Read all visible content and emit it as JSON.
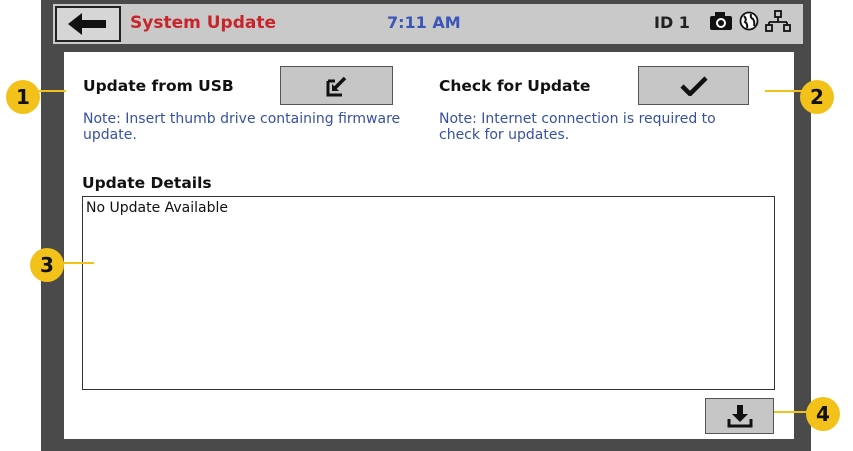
{
  "header": {
    "title": "System Update",
    "time": "7:11 AM",
    "id_label": "ID 1",
    "icons": [
      "back-arrow-icon",
      "camera-icon",
      "globe-icon",
      "network-icon"
    ]
  },
  "usb": {
    "label": "Update from USB",
    "note": "Note:  Insert thumb drive containing firmware update.",
    "icon": "import-icon"
  },
  "check": {
    "label": "Check for Update",
    "note": "Note:  Internet connection is required to check for updates.",
    "icon": "checkmark-icon"
  },
  "details": {
    "label": "Update Details",
    "text": "No Update Available"
  },
  "install": {
    "icon": "download-icon"
  },
  "callouts": [
    "1",
    "2",
    "3",
    "4"
  ],
  "colors": {
    "callout": "#f2c21b",
    "title": "#c8252b",
    "time": "#3b56b8",
    "note": "#3650a6"
  }
}
